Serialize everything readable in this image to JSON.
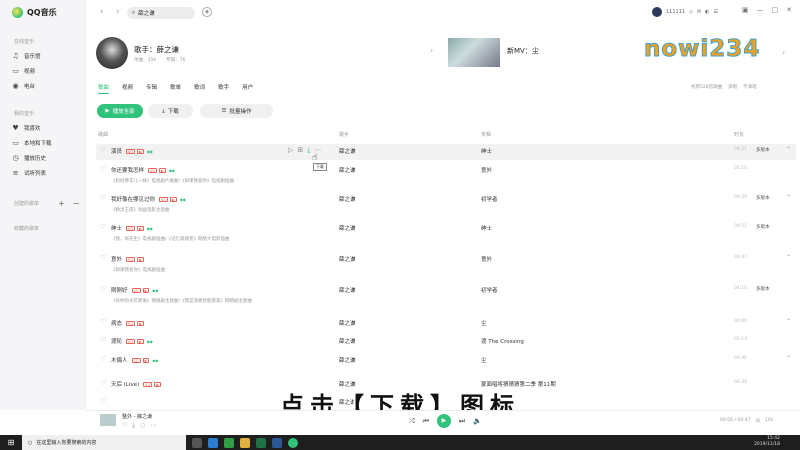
{
  "app": {
    "logo_text": "QQ音乐"
  },
  "sidebar": {
    "sections": [
      {
        "title": "在线音乐",
        "items": [
          {
            "icon": "music-hall-icon",
            "glyph": "♫",
            "label": "音乐馆"
          },
          {
            "icon": "video-icon",
            "glyph": "▭",
            "label": "视频"
          },
          {
            "icon": "radio-icon",
            "glyph": "◉",
            "label": "电台"
          }
        ]
      },
      {
        "title": "我的音乐",
        "items": [
          {
            "icon": "heart-icon",
            "glyph": "♥",
            "label": "我喜欢"
          },
          {
            "icon": "computer-icon",
            "glyph": "▭",
            "label": "本地和下载"
          },
          {
            "icon": "history-icon",
            "glyph": "◷",
            "label": "播放历史"
          },
          {
            "icon": "list-icon",
            "glyph": "≡",
            "label": "试听列表"
          }
        ]
      },
      {
        "title": "创建的歌单",
        "items": []
      },
      {
        "title": "收藏的歌单",
        "items": []
      }
    ]
  },
  "topbar": {
    "search_value": "薛之谦",
    "username": "111111"
  },
  "artist": {
    "name": "歌手：薛之谦",
    "songs_label": "单曲：356",
    "albums_label": "专辑：76",
    "mv_label": "新MV：尘"
  },
  "watermark": "nowi234",
  "tabs": [
    "歌曲",
    "视频",
    "专辑",
    "歌单",
    "歌词",
    "歌手",
    "用户"
  ],
  "tab_right": [
    "找到528首歌曲",
    "演唱",
    "不演唱"
  ],
  "buttons": {
    "play_all": "播放全部",
    "download": "下载",
    "batch": "批量操作"
  },
  "columns": {
    "song": "歌曲",
    "singer": "歌手",
    "album": "专辑",
    "duration": "时长"
  },
  "songs": [
    {
      "title": "演员",
      "sub": "",
      "singer": "薛之谦",
      "album": "绅士",
      "duration": "04:21",
      "version": "多版本",
      "sq": true,
      "mv": true,
      "vip": true
    },
    {
      "title": "你还要我怎样",
      "sub": "《妈妈像花儿一样》电视剧片尾曲/《如果我爱你》电视剧插曲",
      "singer": "薛之谦",
      "album": "意外",
      "duration": "05:10",
      "version": "",
      "sq": true,
      "mv": true,
      "vip": true
    },
    {
      "title": "我好像在哪见过你",
      "sub": "《精灵王座》动画电影主题曲",
      "singer": "薛之谦",
      "album": "初学者",
      "duration": "04:39",
      "version": "多版本",
      "sq": true,
      "mv": true,
      "vip": true
    },
    {
      "title": "绅士",
      "sub": "《我，尚先生》电视剧插曲/《记忆裁缝者》网络大电影插曲",
      "singer": "薛之谦",
      "album": "绅士",
      "duration": "04:51",
      "version": "多版本",
      "sq": true,
      "mv": true,
      "vip": true
    },
    {
      "title": "意外",
      "sub": "《如果我爱你》电视剧插曲",
      "singer": "薛之谦",
      "album": "意外",
      "duration": "04:47",
      "version": "",
      "sq": true,
      "mv": true,
      "vip": false
    },
    {
      "title": "刚刚好",
      "sub": "《有你的光年距离》网络剧主题曲/《我是演奏智能管家》网络剧主题曲",
      "singer": "薛之谦",
      "album": "初学者",
      "duration": "04:10",
      "version": "多版本",
      "sq": true,
      "mv": true,
      "vip": true
    },
    {
      "title": "病态",
      "sub": "",
      "singer": "薛之谦",
      "album": "尘",
      "duration": "04:00",
      "version": "",
      "sq": true,
      "mv": true,
      "vip": false
    },
    {
      "title": "渡轮",
      "sub": "",
      "singer": "薛之谦",
      "album": "渡 The Crossing",
      "duration": "05:13",
      "version": "",
      "sq": true,
      "mv": true,
      "vip": true
    },
    {
      "title": "木偶人",
      "sub": "",
      "singer": "薛之谦",
      "album": "尘",
      "duration": "04:46",
      "version": "",
      "sq": true,
      "mv": true,
      "vip": true
    },
    {
      "title": "天后 (Live)",
      "sub": "",
      "singer": "薛之谦",
      "album": "蒙面唱将猜猜猜第二季 第11期",
      "duration": "04:38",
      "version": "",
      "sq": true,
      "mv": true,
      "vip": false
    },
    {
      "title": "",
      "sub": "",
      "singer": "薛之谦",
      "album": "",
      "duration": "",
      "version": "",
      "sq": false,
      "mv": false,
      "vip": false
    }
  ],
  "tooltip": "下载",
  "caption": "点击【下载】图标",
  "player": {
    "now_playing": "整外 - 薛之谦",
    "time": "00:00 / 04:47",
    "count": "101"
  },
  "taskbar": {
    "search_placeholder": "在这里输入你要搜索的内容",
    "time": "15:42",
    "date": "2019/11/18"
  },
  "colors": {
    "accent": "#31c27c",
    "hq_tag": "#e5685a"
  }
}
